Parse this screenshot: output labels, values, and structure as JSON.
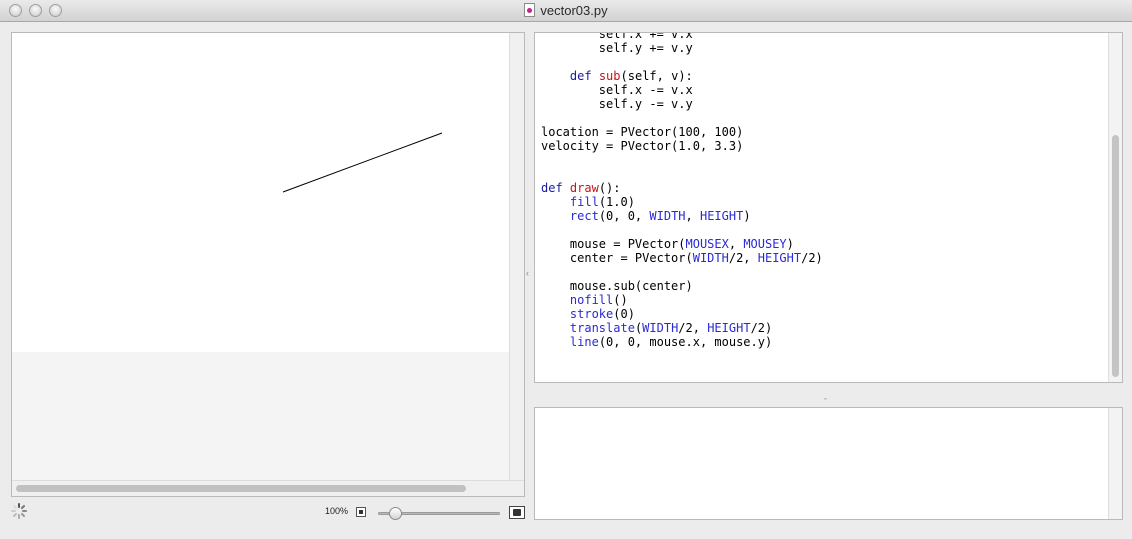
{
  "window": {
    "title": "vector03.py"
  },
  "zoom": {
    "label": "100%",
    "level": 0.1
  },
  "editor": {
    "lines": [
      [
        {
          "t": "        self.x += v.x"
        }
      ],
      [
        {
          "t": "        self.y += v.y"
        }
      ],
      [
        {
          "t": ""
        }
      ],
      [
        {
          "t": "    "
        },
        {
          "t": "def",
          "c": "kw"
        },
        {
          "t": " "
        },
        {
          "t": "sub",
          "c": "fn"
        },
        {
          "t": "(self, v):"
        }
      ],
      [
        {
          "t": "        self.x -= v.x"
        }
      ],
      [
        {
          "t": "        self.y -= v.y"
        }
      ],
      [
        {
          "t": ""
        }
      ],
      [
        {
          "t": "location = PVector(100, 100)"
        }
      ],
      [
        {
          "t": "velocity = PVector(1.0, 3.3)"
        }
      ],
      [
        {
          "t": ""
        }
      ],
      [
        {
          "t": ""
        }
      ],
      [
        {
          "t": "def",
          "c": "kw"
        },
        {
          "t": " "
        },
        {
          "t": "draw",
          "c": "fn"
        },
        {
          "t": "():"
        }
      ],
      [
        {
          "t": "    "
        },
        {
          "t": "fill",
          "c": "bi"
        },
        {
          "t": "(1.0)"
        }
      ],
      [
        {
          "t": "    "
        },
        {
          "t": "rect",
          "c": "bi"
        },
        {
          "t": "(0, 0, "
        },
        {
          "t": "WIDTH",
          "c": "bi"
        },
        {
          "t": ", "
        },
        {
          "t": "HEIGHT",
          "c": "bi"
        },
        {
          "t": ")"
        }
      ],
      [
        {
          "t": ""
        }
      ],
      [
        {
          "t": "    mouse = PVector("
        },
        {
          "t": "MOUSEX",
          "c": "bi"
        },
        {
          "t": ", "
        },
        {
          "t": "MOUSEY",
          "c": "bi"
        },
        {
          "t": ")"
        }
      ],
      [
        {
          "t": "    center = PVector("
        },
        {
          "t": "WIDTH",
          "c": "bi"
        },
        {
          "t": "/2, "
        },
        {
          "t": "HEIGHT",
          "c": "bi"
        },
        {
          "t": "/2)"
        }
      ],
      [
        {
          "t": ""
        }
      ],
      [
        {
          "t": "    mouse.sub(center)"
        }
      ],
      [
        {
          "t": "    "
        },
        {
          "t": "nofill",
          "c": "bi"
        },
        {
          "t": "()"
        }
      ],
      [
        {
          "t": "    "
        },
        {
          "t": "stroke",
          "c": "bi"
        },
        {
          "t": "(0)"
        }
      ],
      [
        {
          "t": "    "
        },
        {
          "t": "translate",
          "c": "bi"
        },
        {
          "t": "("
        },
        {
          "t": "WIDTH",
          "c": "bi"
        },
        {
          "t": "/2, "
        },
        {
          "t": "HEIGHT",
          "c": "bi"
        },
        {
          "t": "/2)"
        }
      ],
      [
        {
          "t": "    "
        },
        {
          "t": "line",
          "c": "bi"
        },
        {
          "t": "(0, 0, mouse.x, mouse.y)"
        }
      ]
    ]
  },
  "console": {
    "text": ""
  }
}
